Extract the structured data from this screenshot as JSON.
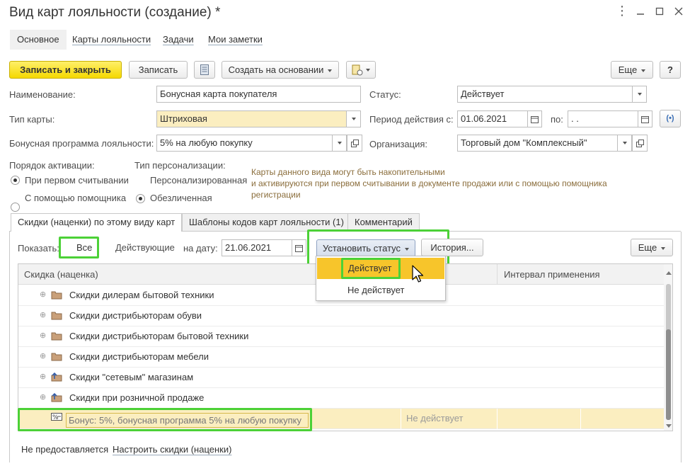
{
  "window": {
    "title": "Вид карт лояльности (создание) *"
  },
  "nav": {
    "tabs": [
      {
        "label": "Основное"
      },
      {
        "label": "Карты лояльности"
      },
      {
        "label": "Задачи"
      },
      {
        "label": "Мои заметки"
      }
    ]
  },
  "toolbar": {
    "save_close": "Записать и закрыть",
    "save": "Записать",
    "create_based": "Создать на основании",
    "more": "Еще",
    "help": "?"
  },
  "form": {
    "name_label": "Наименование:",
    "name_value": "Бонусная карта покупателя",
    "status_label": "Статус:",
    "status_value": "Действует",
    "type_label": "Тип карты:",
    "type_value": "Штриховая",
    "period_label": "Период действия с:",
    "period_from": "01.06.2021",
    "period_to_label": "по:",
    "period_to": " .  .",
    "program_label": "Бонусная программа лояльности:",
    "program_value": "5% на любую покупку",
    "org_label": "Организация:",
    "org_value": "Торговый дом \"Комплексный\""
  },
  "activation": {
    "label": "Порядок активации:",
    "options": [
      "При первом считывании",
      "С помощью помощника"
    ]
  },
  "personalization": {
    "label": "Тип персонализации:",
    "options": [
      "Персонализированная",
      "Обезличенная"
    ]
  },
  "hint": {
    "lines": [
      "Карты данного вида могут быть накопительными",
      "и активируются при первом считывании в документе продажи или с помощью помощника",
      "регистрации"
    ]
  },
  "tabs": [
    {
      "label": "Скидки (наценки) по этому виду карт"
    },
    {
      "label": "Шаблоны кодов карт лояльности (1)"
    },
    {
      "label": "Комментарий"
    }
  ],
  "filter": {
    "show_label": "Показать:",
    "all": "Все",
    "active": "Действующие",
    "date_label": "на дату:",
    "date_value": "21.06.2021",
    "set_status": "Установить статус",
    "history": "История...",
    "more": "Еще"
  },
  "status_menu": {
    "items": [
      "Действует",
      "Не действует"
    ]
  },
  "grid": {
    "col_discount": "Скидка (наценка)",
    "col_interval": "Интервал применения",
    "rows": [
      {
        "name": "Скидки дилерам бытовой техники"
      },
      {
        "name": "Скидки дистрибьюторам обуви"
      },
      {
        "name": "Скидки дистрибьюторам бытовой техники"
      },
      {
        "name": "Скидки дистрибьюторам мебели"
      },
      {
        "name": "Скидки \"сетевым\" магазинам"
      },
      {
        "name": "Скидки при розничной продаже"
      }
    ],
    "selected": {
      "name": "Бонус: 5%, бонусная программа 5% на любую покупку",
      "status": "Не действует"
    }
  },
  "footer": {
    "not_provided": "Не предоставляется",
    "configure_link": "Настроить скидки (наценки)"
  },
  "colors": {
    "accent_yellow": "#f5d900",
    "highlight_green": "#4cd137",
    "selected_row": "#fbeec0",
    "menu_hover": "#f7c52b"
  }
}
